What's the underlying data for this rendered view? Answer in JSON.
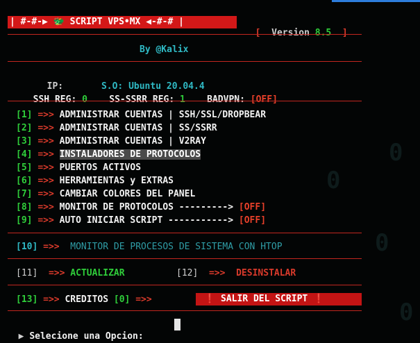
{
  "header": {
    "title": "| #-#-▶ 🐲 SCRIPT VPS•MX ◀-#-# |",
    "version_open": "[",
    "version_label": "Version",
    "version_value": "8.5",
    "version_close": "]",
    "author": "By @Kalix"
  },
  "info": {
    "ip_label": "IP:",
    "so_label": "S.O:",
    "so_value": "Ubuntu 20.04.4",
    "ssh_label": "SSH REG:",
    "ssh_value": "0",
    "ssr_label": "SS-SSRR REG:",
    "ssr_value": "1",
    "badvpn_label": "BADVPN:",
    "badvpn_value": "[OFF]"
  },
  "menu": {
    "arrow": "=>>",
    "items": [
      {
        "num": "[1]",
        "label": "ADMINISTRAR CUENTAS | SSH/SSL/DROPBEAR"
      },
      {
        "num": "[2]",
        "label": "ADMINISTRAR CUENTAS | SS/SSRR"
      },
      {
        "num": "[3]",
        "label": "ADMINISTRAR CUENTAS | V2RAY"
      },
      {
        "num": "[4]",
        "label": "INSTALADORES DE PROTOCOLOS"
      },
      {
        "num": "[5]",
        "label": "PUERTOS ACTIVOS"
      },
      {
        "num": "[6]",
        "label": "HERRAMIENTAS y EXTRAS"
      },
      {
        "num": "[7]",
        "label": "CAMBIAR COLORES DEL PANEL"
      },
      {
        "num": "[8]",
        "label": "MONITOR DE PROTOCOLOS --------->",
        "status": "[OFF]"
      },
      {
        "num": "[9]",
        "label": "AUTO INICIAR SCRIPT ----------->",
        "status": "[OFF]"
      }
    ],
    "item10": {
      "num": "[10]",
      "label": "MONITOR DE PROCESOS DE SISTEMA CON HTOP"
    },
    "item11": {
      "num": "[11]",
      "label": "ACTUALIZAR"
    },
    "item12": {
      "num": "[12]",
      "label": "DESINSTALAR"
    },
    "item13": {
      "num": "[13]",
      "label": "CREDITOS"
    },
    "item0": {
      "num": "[0]",
      "label": "❗ SALIR DEL SCRIPT ❗"
    }
  },
  "prompt": {
    "marker": "▶",
    "text": "Selecione una Opcion:"
  }
}
